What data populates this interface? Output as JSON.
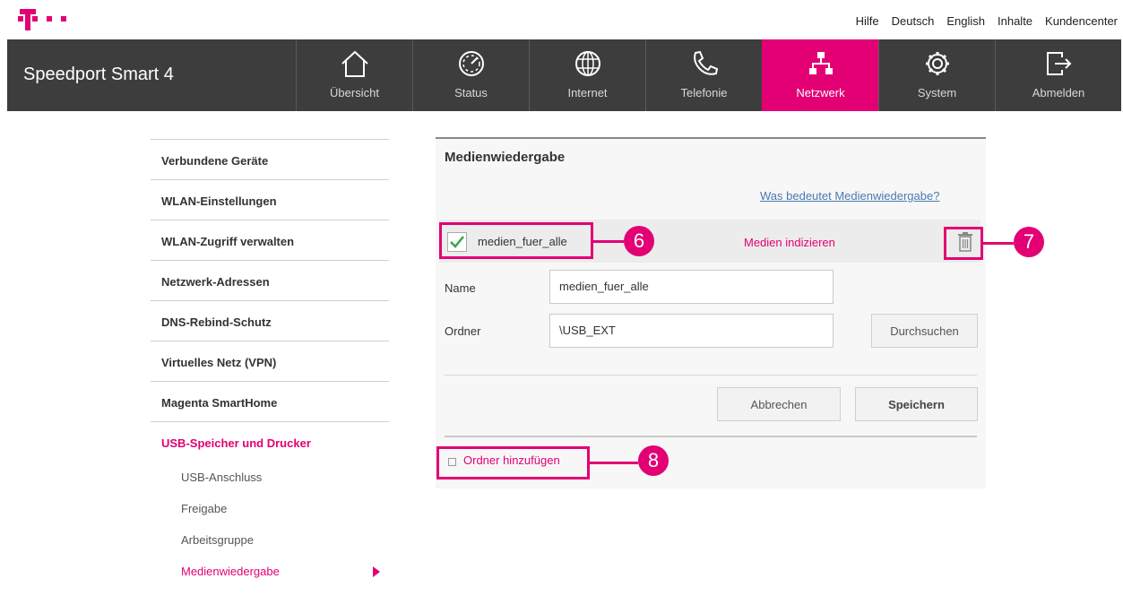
{
  "top_links": [
    "Hilfe",
    "Deutsch",
    "English",
    "Inhalte",
    "Kundencenter"
  ],
  "brand": "Speedport Smart 4",
  "nav": {
    "items": [
      {
        "label": "Übersicht",
        "icon": "home-icon"
      },
      {
        "label": "Status",
        "icon": "gauge-icon"
      },
      {
        "label": "Internet",
        "icon": "globe-icon"
      },
      {
        "label": "Telefonie",
        "icon": "phone-icon"
      },
      {
        "label": "Netzwerk",
        "icon": "network-icon",
        "active": true
      },
      {
        "label": "System",
        "icon": "gear-icon"
      },
      {
        "label": "Abmelden",
        "icon": "logout-icon"
      }
    ]
  },
  "sidebar": {
    "items": [
      {
        "label": "Verbundene Geräte"
      },
      {
        "label": "WLAN-Einstellungen"
      },
      {
        "label": "WLAN-Zugriff verwalten"
      },
      {
        "label": "Netzwerk-Adressen"
      },
      {
        "label": "DNS-Rebind-Schutz"
      },
      {
        "label": "Virtuelles Netz (VPN)"
      },
      {
        "label": "Magenta SmartHome"
      },
      {
        "label": "USB-Speicher und Drucker",
        "active": true
      }
    ],
    "subitems": [
      {
        "label": "USB-Anschluss"
      },
      {
        "label": "Freigabe"
      },
      {
        "label": "Arbeitsgruppe"
      },
      {
        "label": "Medienwiedergabe",
        "active": true
      }
    ]
  },
  "main": {
    "title": "Medienwiedergabe",
    "help_link": "Was bedeutet Medienwiedergabe?",
    "entry": {
      "checked": true,
      "name": "medien_fuer_alle",
      "index_link": "Medien indizieren"
    },
    "form": {
      "name_label": "Name",
      "name_value": "medien_fuer_alle",
      "folder_label": "Ordner",
      "folder_value": "\\USB_EXT",
      "browse_button": "Durchsuchen",
      "cancel_button": "Abbrechen",
      "save_button": "Speichern"
    },
    "add_folder": "Ordner hinzufügen"
  },
  "annotations": [
    "6",
    "7",
    "8"
  ],
  "colors": {
    "accent": "#e20074",
    "navbar": "#3d3d3d",
    "link": "#4a7bb0"
  }
}
